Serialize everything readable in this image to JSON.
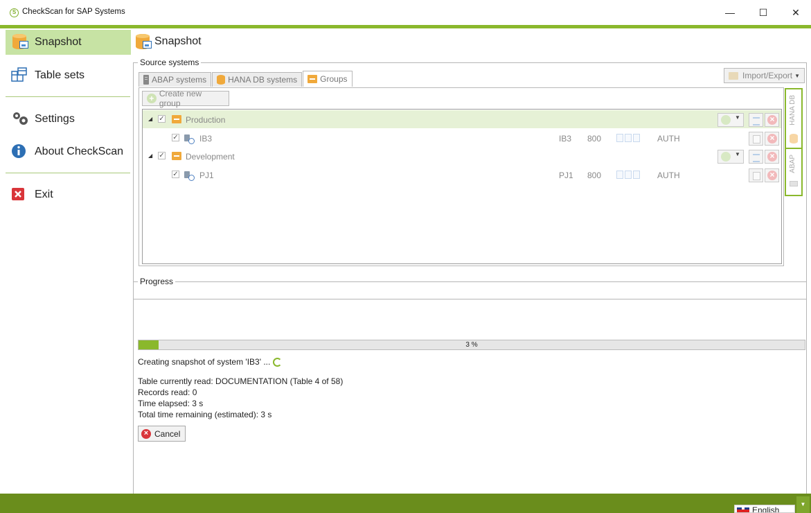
{
  "window": {
    "title": "CheckScan for SAP Systems",
    "app_icon_glyph": "S",
    "minimize_glyph": "—",
    "maximize_glyph": "☐",
    "close_glyph": "✕"
  },
  "colors": {
    "accent": "#8ab82c",
    "active_nav": "#c7e3a4",
    "statusbar": "#6a8d1c"
  },
  "nav": {
    "snapshot": "Snapshot",
    "table_sets": "Table sets",
    "settings": "Settings",
    "about": "About CheckScan",
    "exit": "Exit"
  },
  "page": {
    "title": "Snapshot"
  },
  "source": {
    "legend": "Source systems",
    "tabs": [
      "ABAP systems",
      "HANA DB systems",
      "Groups"
    ],
    "import_export": "Import/Export",
    "create_group": "Create new group",
    "side_tabs": [
      "HANA DB",
      "ABAP"
    ],
    "groups": [
      {
        "name": "Production",
        "checked": "✓",
        "system": {
          "name": "IB3",
          "sid": "IB3",
          "client": "800",
          "type": "AUTH"
        }
      },
      {
        "name": "Development",
        "checked": "✓",
        "system": {
          "name": "PJ1",
          "sid": "PJ1",
          "client": "800",
          "type": "AUTH"
        }
      }
    ]
  },
  "progress": {
    "legend": "Progress",
    "value": 0.03,
    "label": "3 %",
    "status": "Creating snapshot of system 'IB3' ...",
    "table_read": "Table currently read: DOCUMENTATION (Table 4 of 58)",
    "records": "Records read: 0",
    "elapsed": "Time elapsed: 3 s",
    "remaining": "Total time remaining (estimated): 3 s",
    "cancel": "Cancel"
  },
  "statusbar": {
    "language": "English"
  }
}
